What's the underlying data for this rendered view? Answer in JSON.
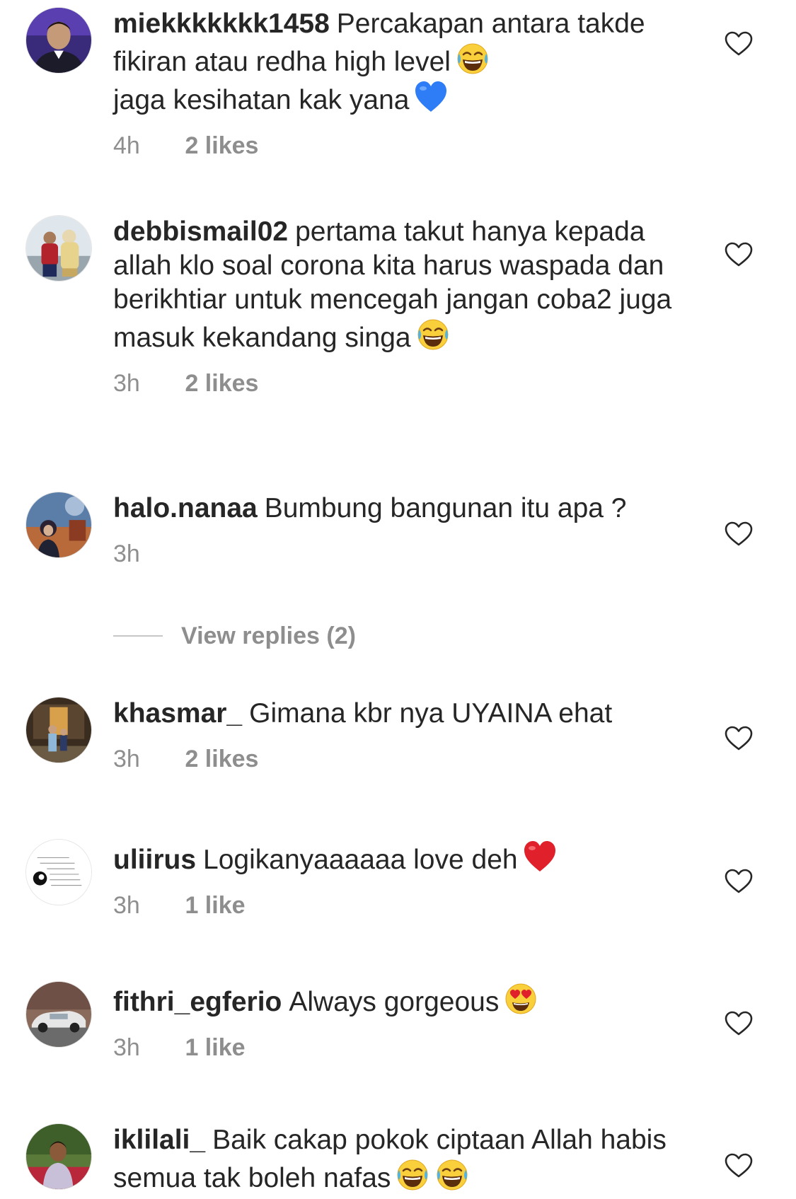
{
  "comments": [
    {
      "username": "miekkkkkkk1458",
      "text": "Percakapan antara takde fikiran atau redha high level",
      "text2": "jaga kesihatan kak yana",
      "time": "4h",
      "likes": "2 likes",
      "emoji": "face-with-tears-of-joy",
      "emoji2": "blue-heart"
    },
    {
      "username": "debbismail02",
      "text": "pertama takut hanya kepada allah klo soal corona kita harus waspada dan berikhtiar untuk mencegah jangan coba2 juga masuk kekandang singa",
      "time": "3h",
      "likes": "2 likes",
      "emoji": "face-with-tears-of-joy"
    },
    {
      "username": "halo.nanaa",
      "text": "Bumbung bangunan itu apa ?",
      "time": "3h",
      "likes": ""
    },
    {
      "username": "khasmar_",
      "text": "Gimana kbr nya UYAINA ehat",
      "time": "3h",
      "likes": "2 likes"
    },
    {
      "username": "uliirus",
      "text": "Logikanyaaaaaa love deh",
      "time": "3h",
      "likes": "1 like",
      "emoji": "red-heart"
    },
    {
      "username": "fithri_egferio",
      "text": "Always gorgeous",
      "time": "3h",
      "likes": "1 like",
      "emoji": "smiling-face-with-heart-eyes"
    },
    {
      "username": "iklilali_",
      "text": "Baik cakap pokok ciptaan Allah habis semua tak boleh nafas",
      "emoji": "face-with-tears-of-joy",
      "emoji2": "face-with-tears-of-joy"
    }
  ],
  "view_replies": "View replies (2)",
  "icons": {
    "like": "heart-outline-icon"
  },
  "colors": {
    "text": "#262626",
    "meta": "#8e8e8e",
    "background": "#ffffff",
    "divider": "#c7c7c7"
  }
}
